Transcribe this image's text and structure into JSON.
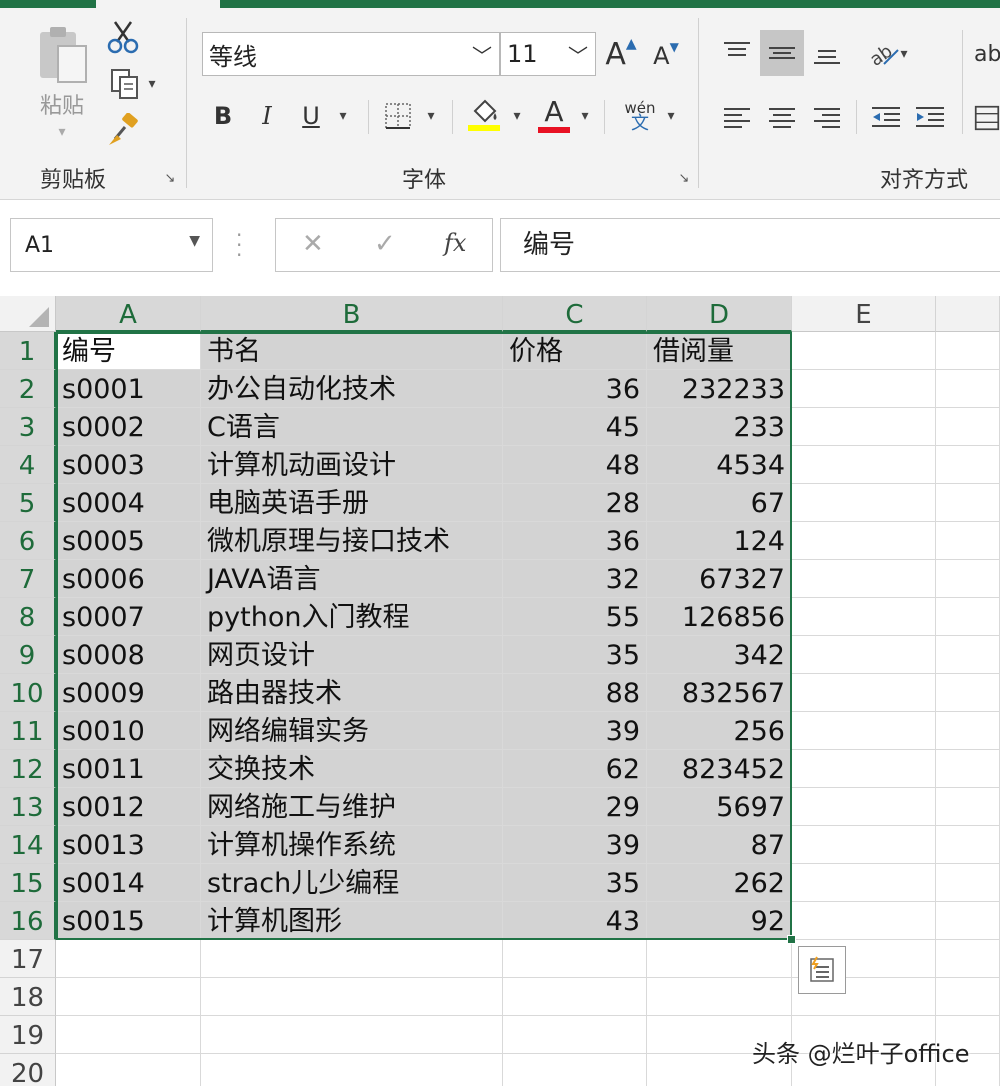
{
  "ribbon": {
    "clipboard": {
      "paste_label": "粘贴",
      "group_label": "剪贴板"
    },
    "font": {
      "font_name": "等线",
      "font_size": "11",
      "bold": "B",
      "italic": "I",
      "underline": "U",
      "phonetic_top": "wén",
      "phonetic_bottom": "文",
      "font_color_glyph": "A",
      "grow_glyph": "A",
      "shrink_glyph": "A",
      "group_label": "字体",
      "highlight_color": "#ffff00",
      "font_color": "#e81123"
    },
    "alignment": {
      "group_label": "对齐方式",
      "wrap_glyph": "ab"
    }
  },
  "formula_bar": {
    "name_box": "A1",
    "formula_value": "编号",
    "cancel_glyph": "✕",
    "enter_glyph": "✓",
    "fx_glyph": "fx"
  },
  "grid": {
    "columns": [
      "A",
      "B",
      "C",
      "D",
      "E"
    ],
    "rows": [
      "1",
      "2",
      "3",
      "4",
      "5",
      "6",
      "7",
      "8",
      "9",
      "10",
      "11",
      "12",
      "13",
      "14",
      "15",
      "16",
      "17",
      "18",
      "19",
      "20"
    ],
    "cells": [
      [
        "编号",
        "书名",
        "价格",
        "借阅量"
      ],
      [
        "s0001",
        "办公自动化技术",
        "36",
        "232233"
      ],
      [
        "s0002",
        "C语言",
        "45",
        "233"
      ],
      [
        "s0003",
        "计算机动画设计",
        "48",
        "4534"
      ],
      [
        "s0004",
        "电脑英语手册",
        "28",
        "67"
      ],
      [
        "s0005",
        "微机原理与接口技术",
        "36",
        "124"
      ],
      [
        "s0006",
        "JAVA语言",
        "32",
        "67327"
      ],
      [
        "s0007",
        "python入门教程",
        "55",
        "126856"
      ],
      [
        "s0008",
        "网页设计",
        "35",
        "342"
      ],
      [
        "s0009",
        "路由器技术",
        "88",
        "832567"
      ],
      [
        "s0010",
        "网络编辑实务",
        "39",
        "256"
      ],
      [
        "s0011",
        "交换技术",
        "62",
        "823452"
      ],
      [
        "s0012",
        "网络施工与维护",
        "29",
        "5697"
      ],
      [
        "s0013",
        "计算机操作系统",
        "39",
        "87"
      ],
      [
        "s0014",
        "strach儿少编程",
        "35",
        "262"
      ],
      [
        "s0015",
        "计算机图形",
        "43",
        "92"
      ]
    ],
    "selection_color": "#217346"
  },
  "watermark": "头条 @烂叶子office"
}
